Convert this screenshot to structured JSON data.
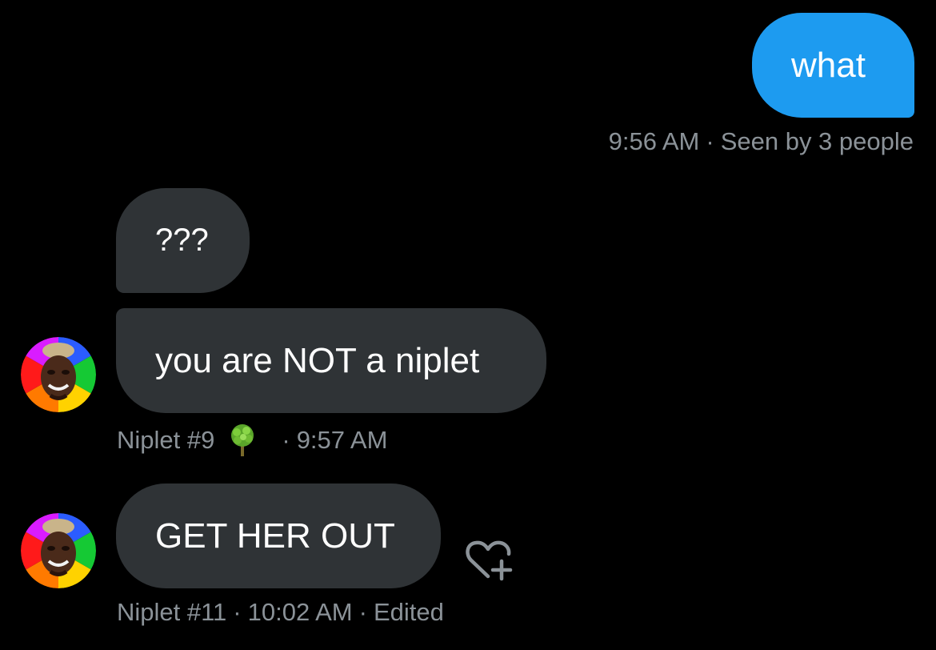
{
  "messages": [
    {
      "direction": "outgoing",
      "text": "what",
      "time": "9:56 AM",
      "status": "Seen by 3 people"
    },
    {
      "direction": "incoming",
      "text": "???"
    },
    {
      "direction": "incoming",
      "text": "you are NOT a niplet",
      "sender": "Niplet #9",
      "time": "9:57 AM"
    },
    {
      "direction": "incoming",
      "text": "GET HER OUT",
      "sender": "Niplet #11",
      "time": "10:02 AM",
      "edited_label": "Edited"
    }
  ],
  "colors": {
    "background": "#000000",
    "outgoing_bubble": "#1d9bf0",
    "incoming_bubble": "#2f3336",
    "meta_text": "#8b9298"
  },
  "icons": {
    "sender_badge": "tree-icon",
    "reaction": "heart-plus-icon"
  }
}
